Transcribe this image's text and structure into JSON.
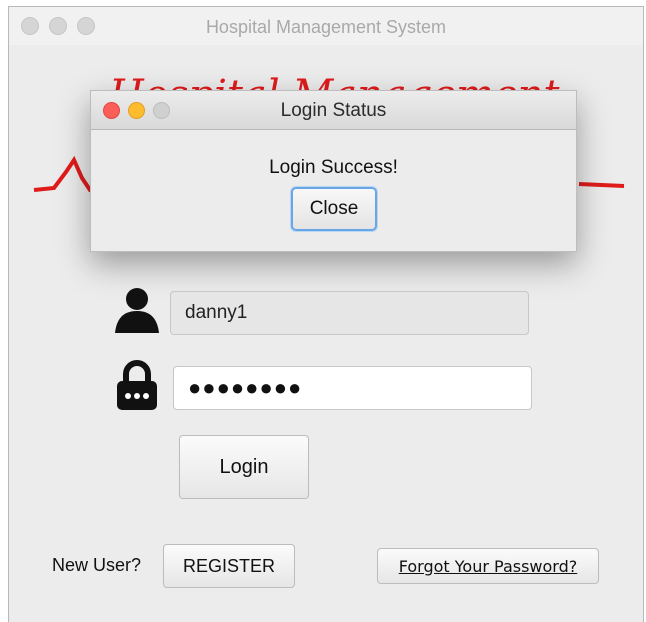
{
  "window": {
    "title": "Hospital Management System"
  },
  "logo": {
    "text": "Hospital Management",
    "color": "#e01b1b"
  },
  "dialog": {
    "title": "Login Status",
    "message": "Login Success!",
    "close_label": "Close"
  },
  "form": {
    "username_value": "danny1",
    "password_mask": "●●●●●●●●",
    "login_label": "Login",
    "new_user_label": "New User?",
    "register_label": "REGISTER",
    "forgot_label": "Forgot Your Password?"
  },
  "icons": {
    "user": "user-icon",
    "lock": "lock-icon"
  },
  "colors": {
    "accent_focus": "#6aa6e3",
    "close_dot": "#fc5f57",
    "minimize_dot": "#fdbc2e"
  }
}
